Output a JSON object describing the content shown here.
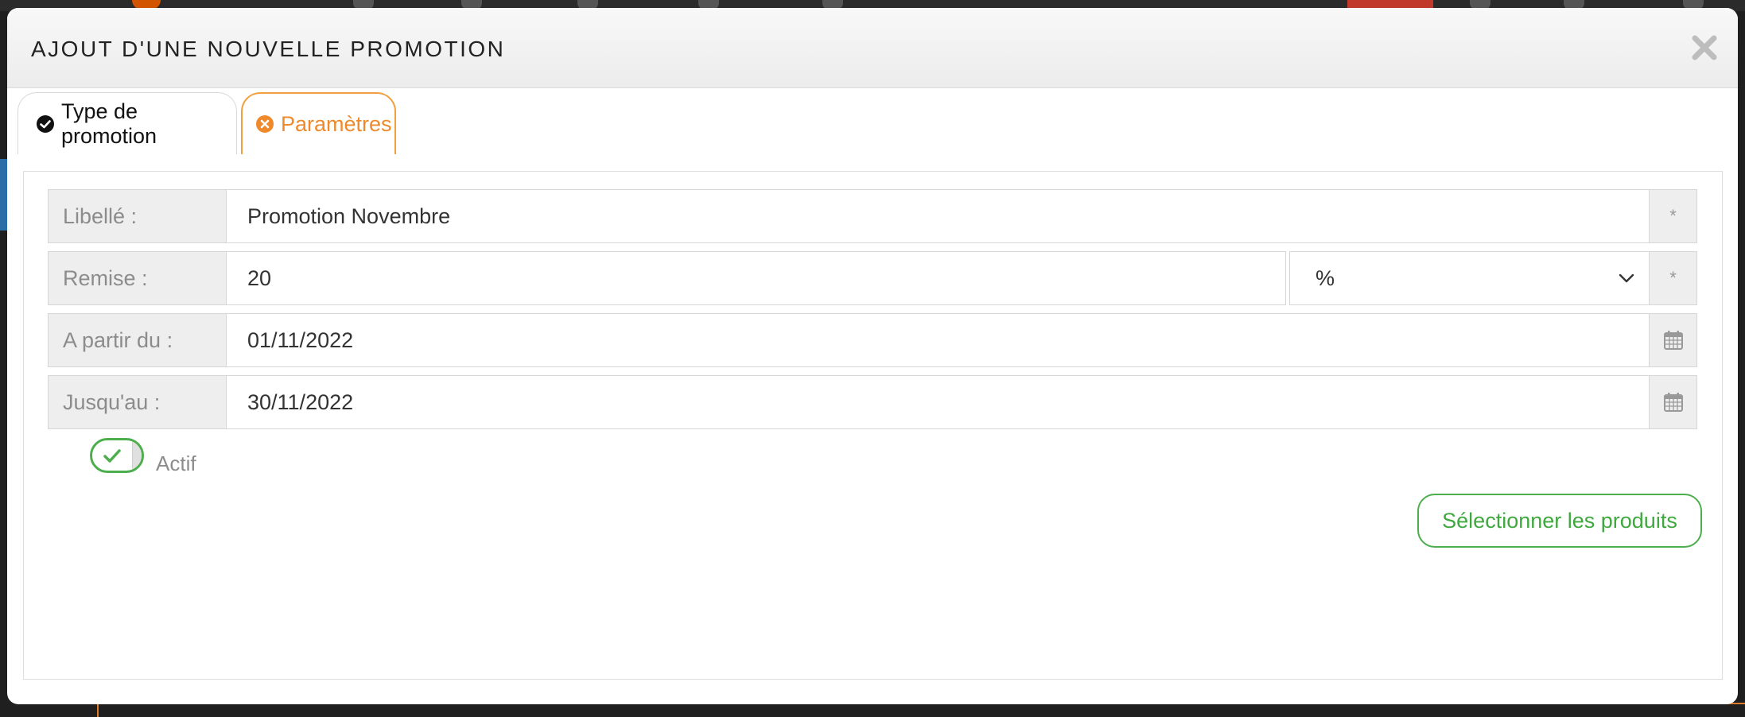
{
  "modal": {
    "title": "AJOUT D'UNE NOUVELLE PROMOTION"
  },
  "tabs": [
    {
      "label": "Type de promotion",
      "icon": "check-circle-icon",
      "state": "completed"
    },
    {
      "label": "Paramètres",
      "icon": "times-circle-icon",
      "state": "active",
      "color": "#ee8a2b"
    }
  ],
  "form": {
    "libelle": {
      "label": "Libellé :",
      "value": "Promotion Novembre",
      "required_mark": "*"
    },
    "remise": {
      "label": "Remise :",
      "value": "20",
      "unit": "%",
      "required_mark": "*"
    },
    "start": {
      "label": "A partir du :",
      "value": "01/11/2022",
      "icon": "calendar-icon"
    },
    "end": {
      "label": "Jusqu'au :",
      "value": "30/11/2022",
      "icon": "calendar-icon"
    },
    "actif": {
      "label": "Actif",
      "checked": true
    }
  },
  "buttons": {
    "select_products": "Sélectionner les produits"
  },
  "colors": {
    "accent_orange": "#ee8a2b",
    "accent_green": "#4cae4c"
  }
}
